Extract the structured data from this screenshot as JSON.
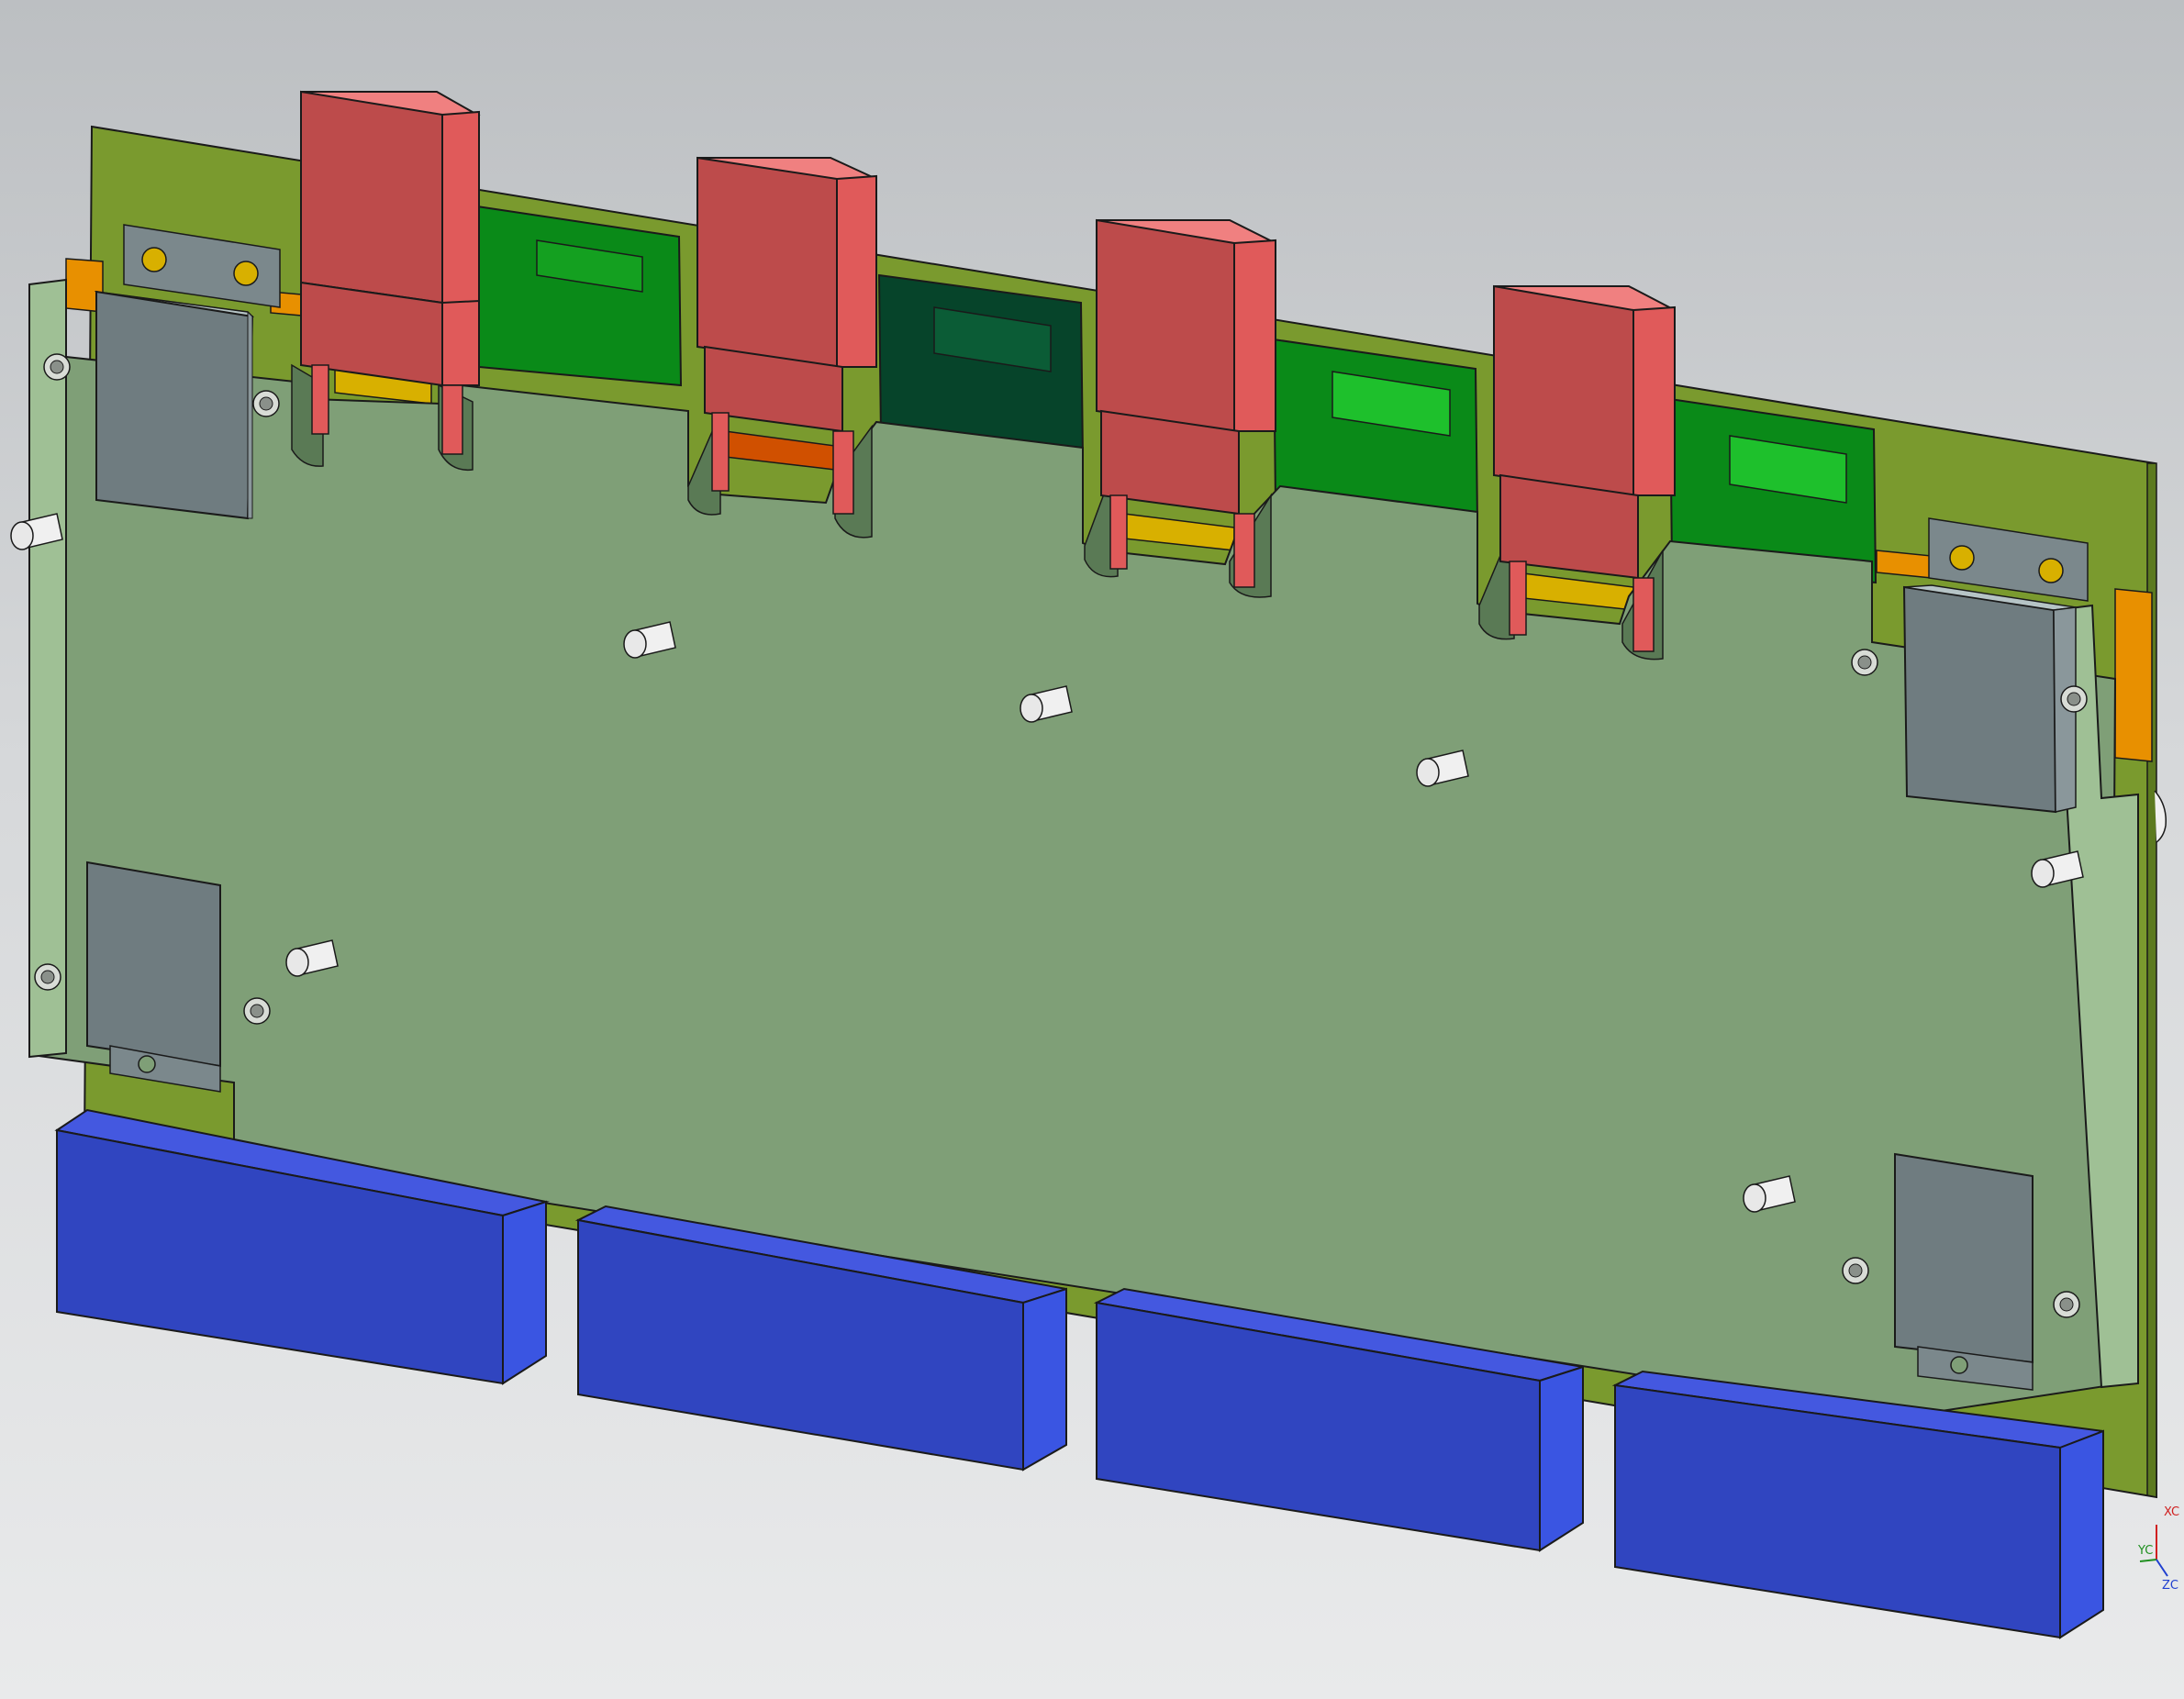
{
  "viewport": {
    "background_top": "#bcbfc2",
    "background_bottom": "#e9eaeb"
  },
  "model_colors": {
    "back_board": "#7a9a2e",
    "front_plate": "#7f9f77",
    "front_plate_edge": "#9fc095",
    "relay_front": "#bd4b4b",
    "relay_top": "#f08080",
    "relay_side": "#e05a5a",
    "connector_front": "#3045c0",
    "connector_top": "#4458e0",
    "connector_side": "#3a55e2",
    "bracket": "#6f7c80",
    "bracket_top": "#b6c4c6",
    "green_module": "#0a8a18",
    "dark_green_module": "#06442a",
    "yellow_pad": "#d8b000",
    "orange_pad": "#e89000",
    "red_part": "#e00000",
    "pin": "#f0f0f0"
  },
  "triad": {
    "x_label": "XC",
    "y_label": "YC",
    "z_label": "ZC",
    "x_color": "#d02020",
    "y_color": "#209020",
    "z_color": "#2040d0"
  }
}
